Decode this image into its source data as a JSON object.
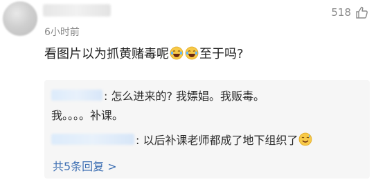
{
  "comment": {
    "time": "6小时前",
    "like_count": "518",
    "text_before": "看图片以为抓黄赌毒呢",
    "text_after": "至于吗?"
  },
  "replies": {
    "reply1_line1": ": 怎么进来的? 我嫖娼。我贩毒。",
    "reply1_line2": "我。。。。补课。",
    "reply2_text": ": 以后补课老师都成了地下组织了",
    "more_link": "共5条回复 >"
  },
  "icons": {
    "like": "thumb-up-icon",
    "laugh": "laughing-tears-emoji",
    "sweat": "sweat-smile-emoji"
  },
  "colors": {
    "link": "#3d6fb3",
    "secondary_text": "#8a8a8a",
    "reply_bg": "#f6f6f6"
  }
}
